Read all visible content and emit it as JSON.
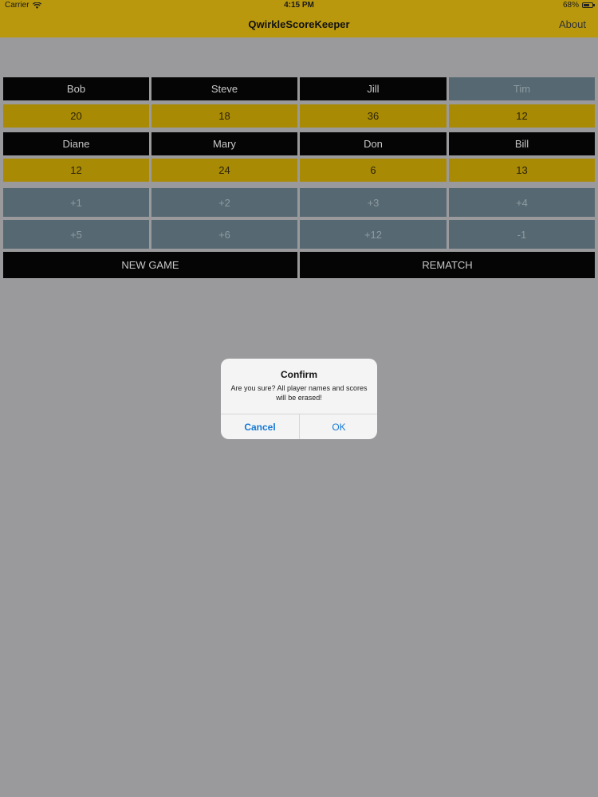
{
  "status_bar": {
    "carrier": "Carrier",
    "time": "4:15 PM",
    "battery": "68%"
  },
  "nav": {
    "title": "QwirkleScoreKeeper",
    "about": "About"
  },
  "players_row1": [
    {
      "name": "Bob",
      "score": "20",
      "active": false
    },
    {
      "name": "Steve",
      "score": "18",
      "active": false
    },
    {
      "name": "Jill",
      "score": "36",
      "active": false
    },
    {
      "name": "Tim",
      "score": "12",
      "active": true
    }
  ],
  "players_row2": [
    {
      "name": "Diane",
      "score": "12"
    },
    {
      "name": "Mary",
      "score": "24"
    },
    {
      "name": "Don",
      "score": "6"
    },
    {
      "name": "Bill",
      "score": "13"
    }
  ],
  "increments_row1": [
    "+1",
    "+2",
    "+3",
    "+4"
  ],
  "increments_row2": [
    "+5",
    "+6",
    "+12",
    "-1"
  ],
  "actions": {
    "new_game": "NEW GAME",
    "rematch": "REMATCH"
  },
  "alert": {
    "title": "Confirm",
    "message": "Are you sure? All player names and scores will be erased!",
    "cancel": "Cancel",
    "ok": "OK"
  },
  "colors": {
    "nav_gold": "#b9980e",
    "score_gold": "#a98a05",
    "name_black": "#050505",
    "active_slate": "#566871",
    "background_gray": "#9a999b",
    "alert_blue": "#1479d4"
  }
}
